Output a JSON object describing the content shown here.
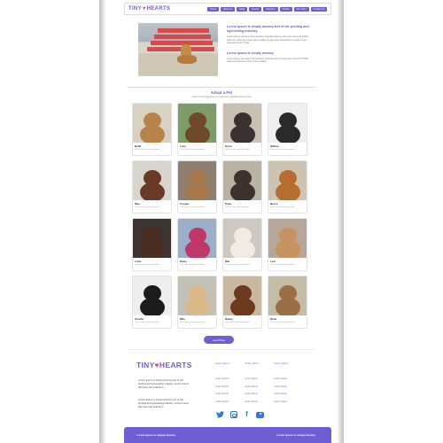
{
  "header": {
    "logo_left": "TINY",
    "logo_heart": "♥",
    "logo_right": "HEARTS",
    "nav": [
      "Home",
      "About us",
      "Adopt",
      "Events",
      "Volunteer",
      "Donate",
      "Our Team",
      "Contact Us"
    ]
  },
  "hero": {
    "title": "Lorem Ipsum is simply dummy text of the printing and typesetting industry.",
    "body1": "Lorem Ipsum has been the industry's standard dummy text ever since the 1500s, when an unknown printer took a galley of type and scrambled it to make a type specimen book. It has",
    "subtitle": "Lorem Ipsum is simply dummy",
    "body2": "Lorem Ipsum has been the industry's standard dummy text ever since the 1500s, when an unknown printer took a galley"
  },
  "adopt": {
    "title": "Adopt a Pet",
    "subtitle": "Lorem Ipsum has been the industry's standard dummy text",
    "pets": [
      {
        "name": "Bella",
        "desc": "Click here to view pet details"
      },
      {
        "name": "Lucy",
        "desc": "Click here to view pet details"
      },
      {
        "name": "Kona",
        "desc": "Click here to view pet details"
      },
      {
        "name": "Willow",
        "desc": "Click here to view pet details"
      },
      {
        "name": "Max",
        "desc": "Click here to view pet details"
      },
      {
        "name": "Cooper",
        "desc": "Click here to view pet details"
      },
      {
        "name": "Piper",
        "desc": "Click here to view pet details"
      },
      {
        "name": "Bruce",
        "desc": "Click here to view pet details"
      },
      {
        "name": "Luna",
        "desc": "Click here to view pet details"
      },
      {
        "name": "Daisy",
        "desc": "Click here to view pet details"
      },
      {
        "name": "Mia",
        "desc": "Click here to view pet details"
      },
      {
        "name": "Lexi",
        "desc": "Click here to view pet details"
      },
      {
        "name": "Charlie",
        "desc": "Click here to view pet details"
      },
      {
        "name": "Milo",
        "desc": "Click here to view pet details"
      },
      {
        "name": "Bailey",
        "desc": "Click here to view pet details"
      },
      {
        "name": "Dixie",
        "desc": "Click here to view pet details"
      }
    ],
    "load_more": "Load More"
  },
  "footer": {
    "logo_left": "TINY",
    "logo_heart": "♥",
    "logo_right": "HEARTS",
    "text1": "Lorem Ipsum is simply dummy text of the printing and typesetting industry. Lorem Ipsum has been the industry's",
    "text2": "Lorem Ipsum is simply dummy text of the printing and typesetting industry. Lorem Ipsum has been the industry's",
    "col_heads": [
      "Lorem Ipsum",
      "Lorem Ipsum",
      "Lorem Ipsum"
    ],
    "links": [
      "Lorem Ipsum",
      "Lorem Ipsum",
      "Lorem Ipsum",
      "Lorem Ipsum",
      "Lorem Ipsum",
      "Lorem Ipsum",
      "Lorem Ipsum",
      "Lorem Ipsum",
      "Lorem Ipsum",
      "Lorem Ipsum",
      "Lorem Ipsum",
      "Lorem Ipsum"
    ],
    "social": [
      "twitter-icon",
      "instagram-icon",
      "facebook-icon",
      "youtube-icon"
    ],
    "bar_left": "Lorem Ipsum is simply dummy",
    "bar_right": "Lorem Ipsum is simply dummy"
  },
  "colors": {
    "accent": "#6b5fd3",
    "heart": "#e8457a",
    "social": "#2a7bd5"
  }
}
